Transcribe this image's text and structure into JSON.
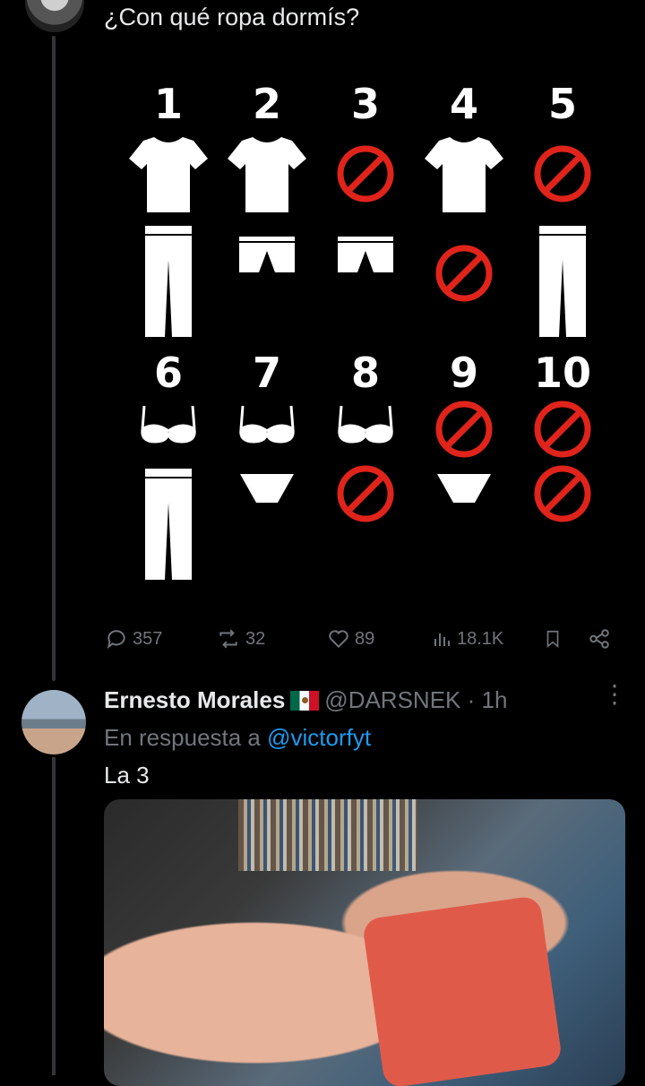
{
  "tweet": {
    "text": "¿Con qué ropa dormís?",
    "grid_top": [
      "1",
      "2",
      "3",
      "4",
      "5"
    ],
    "grid_bottom": [
      "6",
      "7",
      "8",
      "9",
      "10"
    ],
    "stats": {
      "replies": "357",
      "reposts": "32",
      "likes": "89",
      "views": "18.1K"
    }
  },
  "reply": {
    "name": "Ernesto Morales",
    "handle": "@DARSNEK",
    "time": "· 1h",
    "replying_to_prefix": "En respuesta a",
    "replying_to_user": "@victorfyt",
    "text": "La 3"
  },
  "icons": {
    "reply": "reply-icon",
    "repost": "repost-icon",
    "like": "heart-icon",
    "views": "views-icon",
    "bookmark": "bookmark-icon",
    "share": "share-icon",
    "more": "more-icon",
    "no": "prohibited-icon"
  },
  "colors": {
    "accent": "#1d9bf0",
    "muted": "#71767b",
    "prohibit": "#e0241b"
  }
}
